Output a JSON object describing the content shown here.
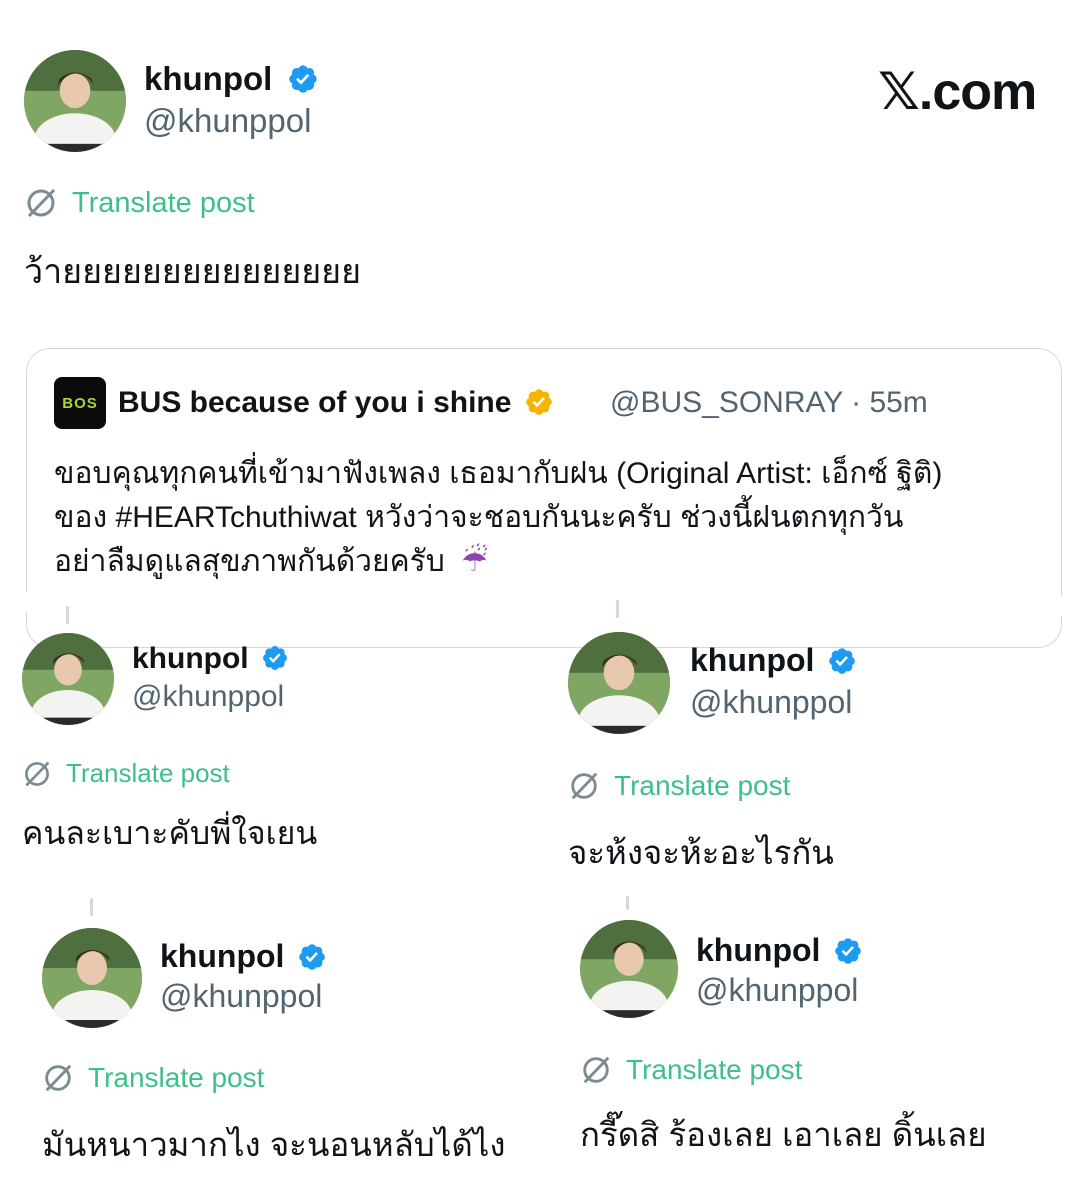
{
  "watermark": "𝕏.com",
  "colors": {
    "verified": "#1d9bf0",
    "gold_verified": "#f4b400",
    "translate": "#3dbf8a",
    "handle": "#536471"
  },
  "main_post": {
    "name": "khunpol",
    "handle": "@khunppol",
    "translate_label": "Translate post",
    "text": "ว้ายยยยยยยยยยยยยยย"
  },
  "quoted": {
    "logo_text": "BOS",
    "name": "BUS because of you i shine",
    "handle": "@BUS_SONRAY",
    "separator": "·",
    "time": "55m",
    "lines": [
      "ขอบคุณทุกคนที่เข้ามาฟังเพลง เธอมากับฝน (Original Artist: เอ็กซ์ ฐิติ)",
      "ของ #HEARTchuthiwat หวังว่าจะชอบกันนะครับ ช่วงนี้ฝนตกทุกวัน",
      "อย่าลืมดูแลสุขภาพกันด้วยครับ"
    ],
    "emoji": "☔"
  },
  "replies": [
    {
      "name": "khunpol",
      "handle": "@khunppol",
      "translate_label": "Translate post",
      "text": "คนละเบาะคับพี่ใจเยน"
    },
    {
      "name": "khunpol",
      "handle": "@khunppol",
      "translate_label": "Translate post",
      "text": "จะห้งจะห้ะอะไรกัน"
    },
    {
      "name": "khunpol",
      "handle": "@khunppol",
      "translate_label": "Translate post",
      "text": "มันหนาวมากไง จะนอนหลับได้ไง"
    },
    {
      "name": "khunpol",
      "handle": "@khunppol",
      "translate_label": "Translate post",
      "text": "กรี๊ดสิ ร้องเลย เอาเลย ดิ้นเลย"
    }
  ]
}
